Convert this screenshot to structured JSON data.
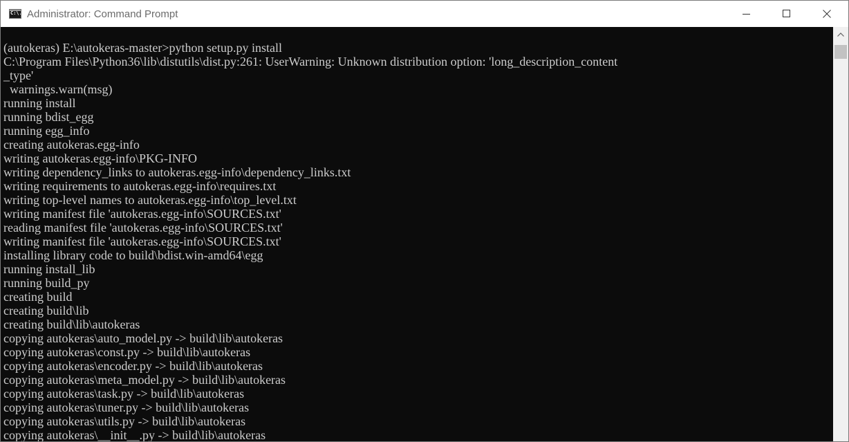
{
  "window": {
    "title": "Administrator: Command Prompt",
    "icon_name": "cmd-icon",
    "icon_label": "C:\\.",
    "buttons": [
      "minimize-icon",
      "maximize-icon",
      "close-icon"
    ]
  },
  "colors": {
    "console_background": "#0c0c0c",
    "console_text": "#cccccc",
    "titlebar_background": "#ffffff",
    "title_text": "#6b6b6b",
    "scrollbar_track": "#f0f0f0",
    "scrollbar_thumb": "#c2c2c2"
  },
  "console": {
    "lines": [
      "(autokeras) E:\\autokeras-master>python setup.py install",
      "C:\\Program Files\\Python36\\lib\\distutils\\dist.py:261: UserWarning: Unknown distribution option: 'long_description_content",
      "_type'",
      "  warnings.warn(msg)",
      "running install",
      "running bdist_egg",
      "running egg_info",
      "creating autokeras.egg-info",
      "writing autokeras.egg-info\\PKG-INFO",
      "writing dependency_links to autokeras.egg-info\\dependency_links.txt",
      "writing requirements to autokeras.egg-info\\requires.txt",
      "writing top-level names to autokeras.egg-info\\top_level.txt",
      "writing manifest file 'autokeras.egg-info\\SOURCES.txt'",
      "reading manifest file 'autokeras.egg-info\\SOURCES.txt'",
      "writing manifest file 'autokeras.egg-info\\SOURCES.txt'",
      "installing library code to build\\bdist.win-amd64\\egg",
      "running install_lib",
      "running build_py",
      "creating build",
      "creating build\\lib",
      "creating build\\lib\\autokeras",
      "copying autokeras\\auto_model.py -> build\\lib\\autokeras",
      "copying autokeras\\const.py -> build\\lib\\autokeras",
      "copying autokeras\\encoder.py -> build\\lib\\autokeras",
      "copying autokeras\\meta_model.py -> build\\lib\\autokeras",
      "copying autokeras\\task.py -> build\\lib\\autokeras",
      "copying autokeras\\tuner.py -> build\\lib\\autokeras",
      "copying autokeras\\utils.py -> build\\lib\\autokeras",
      "copying autokeras\\__init__.py -> build\\lib\\autokeras"
    ]
  }
}
